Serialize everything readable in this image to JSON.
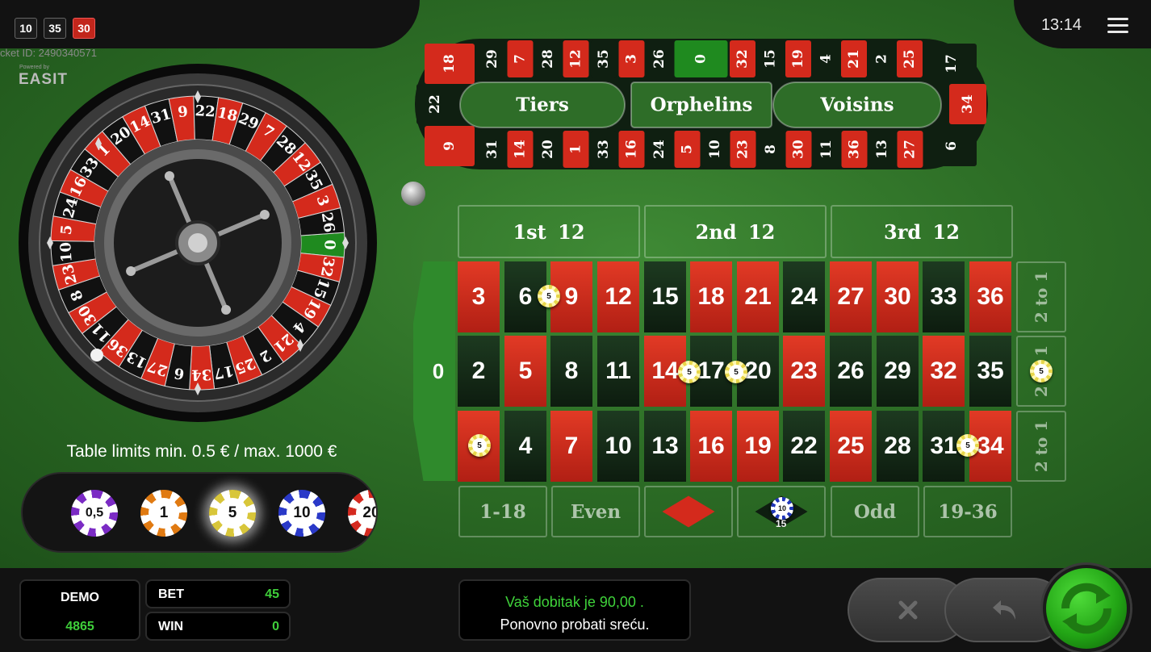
{
  "recent_numbers": [
    {
      "value": "10",
      "color": "black"
    },
    {
      "value": "35",
      "color": "black"
    },
    {
      "value": "30",
      "color": "red"
    }
  ],
  "ticket_id": "cket ID: 2490340571",
  "powered_by": "Powered by",
  "brand": "EASIT",
  "clock": "13:14",
  "table_limits": "Table limits min. 0.5 € / max. 1000 €",
  "chips": [
    {
      "label": "0,5",
      "color": "#7b2bc4"
    },
    {
      "label": "1",
      "color": "#e07a12"
    },
    {
      "label": "5",
      "color": "#d8c63a",
      "selected": true
    },
    {
      "label": "10",
      "color": "#2a39c8"
    },
    {
      "label": "20",
      "color": "#d42a20"
    }
  ],
  "wheel_numbers": [
    "0",
    "32",
    "15",
    "19",
    "4",
    "21",
    "2",
    "25",
    "17",
    "34",
    "6",
    "27",
    "13",
    "36",
    "11",
    "30",
    "8",
    "23",
    "10",
    "5",
    "24",
    "16",
    "33",
    "1",
    "20",
    "14",
    "31",
    "9",
    "22",
    "18",
    "29",
    "7",
    "28",
    "12",
    "35",
    "3",
    "26"
  ],
  "racetrack": {
    "top_row": [
      "29",
      "7",
      "28",
      "12",
      "35",
      "3",
      "26",
      "0",
      "32",
      "15",
      "19",
      "4",
      "21",
      "2",
      "25"
    ],
    "bottom_row": [
      "31",
      "14",
      "20",
      "1",
      "33",
      "16",
      "24",
      "5",
      "10",
      "23",
      "8",
      "30",
      "11",
      "36",
      "13",
      "27"
    ],
    "left_end": [
      "18",
      "22",
      "9"
    ],
    "right_end": [
      "17",
      "34",
      "6"
    ],
    "sections": [
      "Tiers",
      "Orphelins",
      "Voisins"
    ]
  },
  "dozens": [
    "1st 12",
    "2nd 12",
    "3rd 12"
  ],
  "zero_label": "0",
  "grid_rows": [
    [
      "3",
      "6",
      "9",
      "12",
      "15",
      "18",
      "21",
      "24",
      "27",
      "30",
      "33",
      "36"
    ],
    [
      "2",
      "5",
      "8",
      "11",
      "14",
      "17",
      "20",
      "23",
      "26",
      "29",
      "32",
      "35"
    ],
    [
      "1",
      "4",
      "7",
      "10",
      "13",
      "16",
      "19",
      "22",
      "25",
      "28",
      "31",
      "34"
    ]
  ],
  "red_numbers": [
    "1",
    "3",
    "5",
    "7",
    "9",
    "12",
    "14",
    "16",
    "18",
    "19",
    "21",
    "23",
    "25",
    "27",
    "30",
    "32",
    "34",
    "36"
  ],
  "columns": [
    "2 to 1",
    "2 to 1",
    "2 to 1"
  ],
  "outside_bets": [
    "1-18",
    "Even",
    "Odd",
    "19-36"
  ],
  "placed_chips": [
    {
      "label": "5"
    },
    {
      "label": "5"
    },
    {
      "label": "5"
    },
    {
      "label": "5"
    },
    {
      "label": "5"
    },
    {
      "label": "5"
    },
    {
      "label": "10",
      "sum": "15"
    }
  ],
  "status": {
    "demo_label": "DEMO",
    "demo_value": "4865",
    "bet_label": "BET",
    "bet_value": "45",
    "win_label": "WIN",
    "win_value": "0"
  },
  "message": {
    "line1": "Vaš dobitak je 90,00 .",
    "line2": "Ponovno probati sreću."
  },
  "colors": {
    "red": "#d42a1c",
    "green": "#2f8a2c",
    "accent_green": "#3fcf3a"
  }
}
